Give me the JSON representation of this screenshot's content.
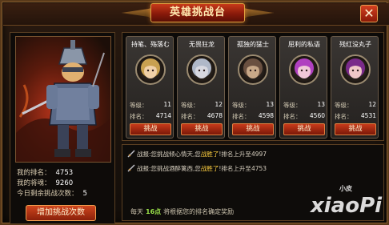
{
  "title": "英雄挑战台",
  "close_label": "✕",
  "player": {
    "rank_label": "我的排名：",
    "rank": "4753",
    "souls_label": "我的将魂：",
    "souls": "9260",
    "remaining_label": "今日剩余挑战次数：",
    "remaining": "5",
    "add_button": "增加挑战次数"
  },
  "labels": {
    "level": "等级：",
    "rank": "排名：",
    "challenge": "挑战"
  },
  "opponents": [
    {
      "name": "持笔、殇落む",
      "level": "11",
      "rank": "4714",
      "hair": "#c8a050",
      "face": "#f0d0a8"
    },
    {
      "name": "无畏狂龙",
      "level": "12",
      "rank": "4678",
      "hair": "#b0b8c8",
      "face": "#d8d8e0"
    },
    {
      "name": "孤独的猛士",
      "level": "13",
      "rank": "4598",
      "hair": "#6a5040",
      "face": "#c8a888"
    },
    {
      "name": "屈利的私语",
      "level": "13",
      "rank": "4560",
      "hair": "#b040c0",
      "face": "#f0c8d8"
    },
    {
      "name": "残红没丸子",
      "level": "12",
      "rank": "4531",
      "hair": "#7a2a8a",
      "face": "#f0c8c8"
    }
  ],
  "log": [
    {
      "prefix": "战报:您挑战",
      "target": "倾心情天",
      "mid": ",您",
      "result": "战胜了",
      "suffix": "!排名上升至",
      "rank": "4997"
    },
    {
      "prefix": "战报:您挑战",
      "target": "酒醉篱西",
      "mid": ",您",
      "result": "战胜了",
      "suffix": "!排名上升至",
      "rank": "4753"
    }
  ],
  "footer": {
    "pre": "每天",
    "time": "16点",
    "post": "将根据您的排名确定奖励"
  },
  "watermark": {
    "small": "小皮",
    "big": "xiaoPi"
  },
  "colors": {
    "accent": "#c83a1a",
    "gold": "#e0a040",
    "win": "#ffd040",
    "highlight": "#9be24a"
  }
}
